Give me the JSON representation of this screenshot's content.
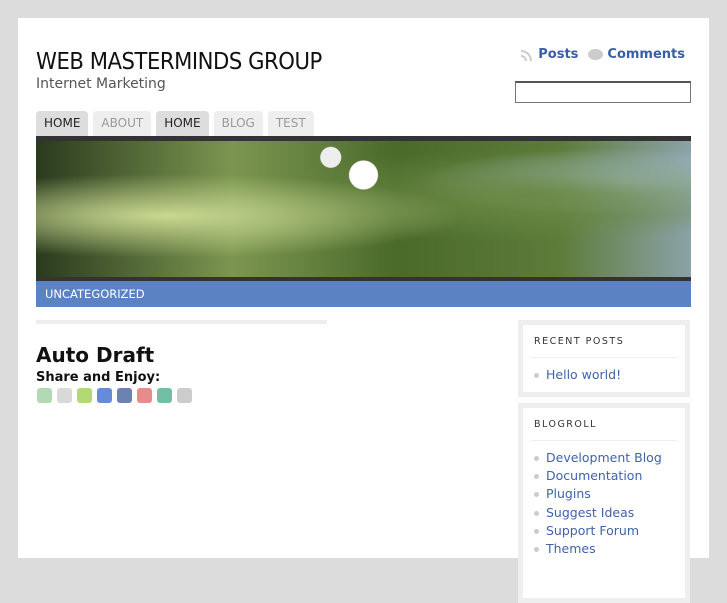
{
  "site": {
    "title": "WEB MASTERMINDS GROUP",
    "tagline": "Internet Marketing"
  },
  "feeds": {
    "posts": "Posts",
    "comments": "Comments"
  },
  "search": {
    "value": ""
  },
  "nav": [
    "HOME",
    "ABOUT",
    "HOME",
    "BLOG",
    "TEST"
  ],
  "category": "UNCATEGORIZED",
  "post": {
    "title": "Auto Draft",
    "share": "Share and Enjoy:"
  },
  "share_icons": [
    {
      "name": "print-icon",
      "color": "#9c9"
    },
    {
      "name": "digg-icon",
      "color": "#ccc"
    },
    {
      "name": "sphinn-icon",
      "color": "#9c4"
    },
    {
      "name": "delicious-icon",
      "color": "#36c"
    },
    {
      "name": "facebook-icon",
      "color": "#3b5998"
    },
    {
      "name": "mixx-icon",
      "color": "#d66"
    },
    {
      "name": "google-icon",
      "color": "#4a8"
    },
    {
      "name": "info-icon",
      "color": "#bbb"
    }
  ],
  "sidebar": {
    "recent": {
      "title": "RECENT POSTS",
      "items": [
        "Hello world!"
      ]
    },
    "blogroll": {
      "title": "BLOGROLL",
      "items": [
        "Development Blog",
        "Documentation",
        "Plugins",
        "Suggest Ideas",
        "Support Forum",
        "Themes"
      ]
    }
  }
}
